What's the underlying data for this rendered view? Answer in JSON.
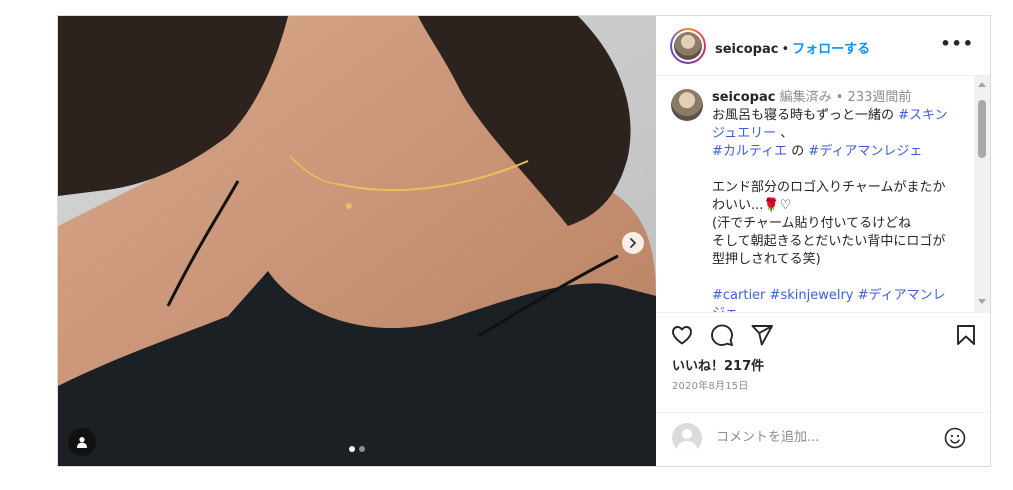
{
  "header": {
    "username": "seicopac",
    "separator": "•",
    "follow_label": "フォローする",
    "more_label": "•••"
  },
  "caption": {
    "username": "seicopac",
    "edited": "編集済み",
    "separator": "•",
    "time_ago": "233週間前",
    "line1_pre": "お風呂も寝る時もずっと一緒の",
    "tag_skin": "#スキンジュエリー",
    "line1_post": "、",
    "tag_cartier_jp": "#カルティエ",
    "no": "の",
    "tag_diamant_legere": "#ディアマンレジェ",
    "line3": "エンド部分のロゴ入りチャームがまたかわいい...🌹♡",
    "line4": "(汗でチャーム貼り付いてるけどね",
    "line5": "そして朝起きるとだいたい背中にロゴが型押しされてる笑)",
    "tag_cartier": "#cartier",
    "tag_skinjewelry": "#skinjewelry",
    "tag_diamant2": "#ディアマンレジェ"
  },
  "actions": {
    "likes": "いいね！217件",
    "date": "2020年8月15日"
  },
  "comment": {
    "placeholder": "コメントを追加..."
  },
  "icons": {
    "heart": "heart-icon",
    "comment": "comment-icon",
    "share": "share-icon",
    "save": "bookmark-icon",
    "emoji": "emoji-icon",
    "next": "chevron-right-icon",
    "user_tag": "user-tag-icon",
    "more": "more-options-icon"
  },
  "colors": {
    "link": "#0095f6",
    "hashtag": "#3a5fd9",
    "muted": "#8e8e8e",
    "text": "#262626"
  },
  "carousel": {
    "slide_count": 2,
    "active_index": 0
  }
}
